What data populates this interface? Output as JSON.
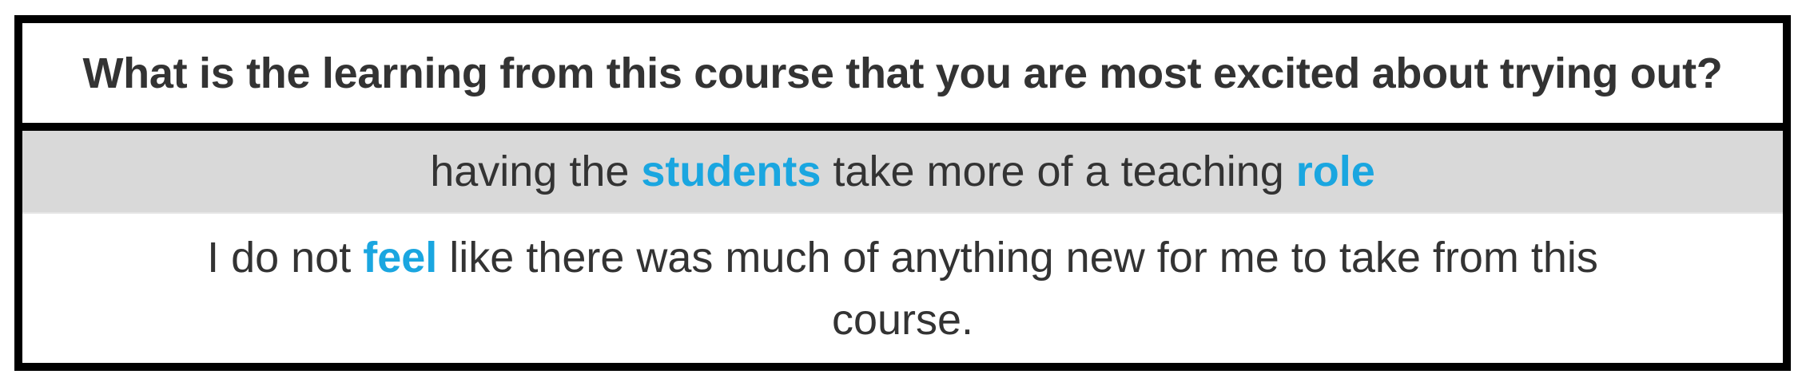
{
  "question": "What is the learning from this course that you are most excited about trying out?",
  "colors": {
    "border": "#000000",
    "text": "#333333",
    "keyword": "#1aa6e0",
    "row_shaded": "#d9d9d9",
    "row_plain": "#ffffff"
  },
  "responses": [
    {
      "parts": [
        {
          "text": "having the ",
          "keyword": false
        },
        {
          "text": "students",
          "keyword": true
        },
        {
          "text": " take more of a teaching ",
          "keyword": false
        },
        {
          "text": "role",
          "keyword": true
        }
      ]
    },
    {
      "parts": [
        {
          "text": "I do not ",
          "keyword": false
        },
        {
          "text": "feel",
          "keyword": true
        },
        {
          "text": " like there was much of anything new for me to take from this course.",
          "keyword": false
        }
      ]
    }
  ]
}
